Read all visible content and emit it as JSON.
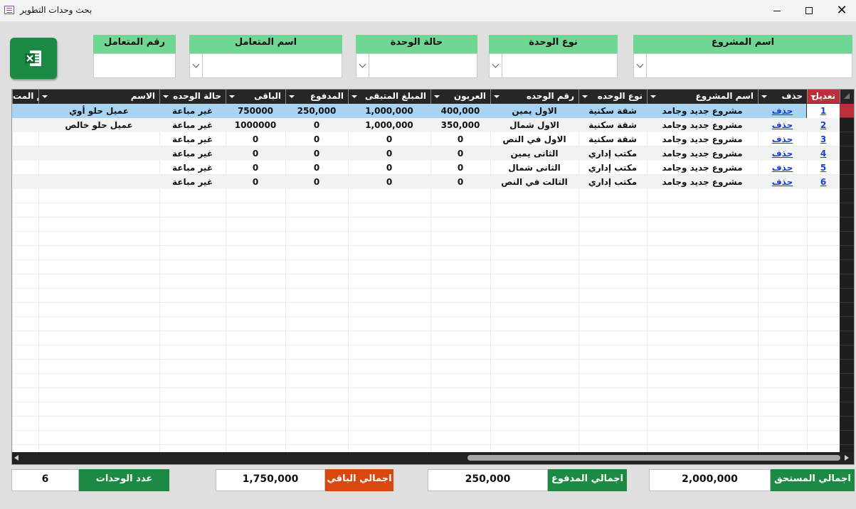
{
  "window": {
    "title": "بحث وحدات التطوير",
    "close_glyph": "✕"
  },
  "toolbar": {
    "excel_export_icon": "excel-icon"
  },
  "filters": {
    "project_name": {
      "label": "اسم المشروع",
      "value": ""
    },
    "unit_type": {
      "label": "نوع الوحدة",
      "value": ""
    },
    "unit_status": {
      "label": "حالة الوحدة",
      "value": ""
    },
    "client_name": {
      "label": "اسم المتعامل",
      "value": ""
    },
    "client_number": {
      "label": "رقم المتعامل",
      "value": ""
    }
  },
  "grid": {
    "headers": {
      "edit": "تعديل",
      "delete": "حذف",
      "project": "اسم المشروع",
      "unit_type": "نوع الوحده",
      "unit_no": "رقم الوحده",
      "deposit": "العربون",
      "remaining_amount": "المبلغ المتبقى",
      "paid": "المدفوع",
      "balance": "الباقى",
      "status": "حالة الوحده",
      "name": "الاسم",
      "client_no": "رقم المت"
    },
    "rows": [
      {
        "edit": "1",
        "delete": "حذف",
        "project": "مشروع جديد وجامد",
        "unit_type": "شقة سكنية",
        "unit_no": "الاول يمين",
        "deposit": "400,000",
        "remaining_amount": "1,000,000",
        "paid": "250,000",
        "balance": "750000",
        "status": "غير مباعة",
        "name": "عميل حلو أوي",
        "client_no": ""
      },
      {
        "edit": "2",
        "delete": "حذف",
        "project": "مشروع جديد وجامد",
        "unit_type": "شقة سكنية",
        "unit_no": "الاول شمال",
        "deposit": "350,000",
        "remaining_amount": "1,000,000",
        "paid": "0",
        "balance": "1000000",
        "status": "غير مباعة",
        "name": "عميل حلو خالص",
        "client_no": ""
      },
      {
        "edit": "3",
        "delete": "حذف",
        "project": "مشروع جديد وجامد",
        "unit_type": "شقة سكنية",
        "unit_no": "الاول في النص",
        "deposit": "0",
        "remaining_amount": "0",
        "paid": "0",
        "balance": "0",
        "status": "غير مباعة",
        "name": "",
        "client_no": ""
      },
      {
        "edit": "4",
        "delete": "حذف",
        "project": "مشروع جديد وجامد",
        "unit_type": "مكتب إداري",
        "unit_no": "الثانى يمين",
        "deposit": "0",
        "remaining_amount": "0",
        "paid": "0",
        "balance": "0",
        "status": "غير مباعة",
        "name": "",
        "client_no": ""
      },
      {
        "edit": "5",
        "delete": "حذف",
        "project": "مشروع جديد وجامد",
        "unit_type": "مكتب إداري",
        "unit_no": "الثانى شمال",
        "deposit": "0",
        "remaining_amount": "0",
        "paid": "0",
        "balance": "0",
        "status": "غير مباعة",
        "name": "",
        "client_no": ""
      },
      {
        "edit": "6",
        "delete": "حذف",
        "project": "مشروع جديد وجامد",
        "unit_type": "مكتب إداري",
        "unit_no": "التالت في النص",
        "deposit": "0",
        "remaining_amount": "0",
        "paid": "0",
        "balance": "0",
        "status": "غير مباعة",
        "name": "",
        "client_no": ""
      }
    ]
  },
  "totals": {
    "due_label": "اجمالي المستحق",
    "due_value": "2,000,000",
    "paid_label": "اجمالي المدفوع",
    "paid_value": "250,000",
    "remaining_label": "اجمالي الباقي",
    "remaining_value": "1,750,000",
    "units_label": "عدد الوحدات",
    "units_value": "6"
  },
  "colors": {
    "green_label": "#70d693",
    "dark_green": "#1d8a44",
    "orange": "#d9480f",
    "active_header": "#b9313b",
    "selected_row": "#a9d3f3"
  }
}
